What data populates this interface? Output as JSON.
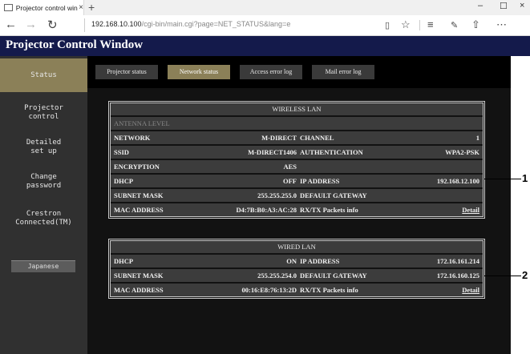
{
  "browser": {
    "tab_title": "Projector control windov",
    "tab_close": "×",
    "new_tab": "+",
    "window_controls": {
      "minimize": "–",
      "maximize": "☐",
      "close": "×"
    },
    "nav": {
      "back": "←",
      "forward": "→",
      "refresh": "↻"
    },
    "url_host": "192.168.10.100",
    "url_path": "/cgi-bin/main.cgi?page=NET_STATUS&lang=e",
    "toolbar_icons": [
      "reading-view-icon",
      "favorites-star-icon",
      "hub-icon",
      "web-note-icon",
      "share-icon",
      "more-icon"
    ]
  },
  "page": {
    "title": "Projector Control Window"
  },
  "sidebar": {
    "items": [
      {
        "label": "Status",
        "active": true
      },
      {
        "label": "Projector\ncontrol",
        "active": false
      },
      {
        "label": "Detailed\nset up",
        "active": false
      },
      {
        "label": "Change\npassword",
        "active": false
      },
      {
        "label": "Crestron\nConnected(TM)",
        "active": false
      }
    ],
    "language_button": "Japanese"
  },
  "subnav": {
    "tabs": [
      {
        "label": "Projector status",
        "active": false
      },
      {
        "label": "Network status",
        "active": true
      },
      {
        "label": "Access error log",
        "active": false
      },
      {
        "label": "Mail error log",
        "active": false
      }
    ]
  },
  "wireless": {
    "header": "WIRELESS LAN",
    "antenna_label": "ANTENNA LEVEL",
    "network_label": "NETWORK",
    "network_value": "M-DIRECT",
    "channel_label": "CHANNEL",
    "channel_value": "1",
    "ssid_label": "SSID",
    "ssid_value": "M-DIRECT1406",
    "auth_label": "AUTHENTICATION",
    "auth_value": "WPA2-PSK",
    "encryption_label": "ENCRYPTION",
    "encryption_value": "AES",
    "dhcp_label": "DHCP",
    "dhcp_value": "OFF",
    "ip_label": "IP ADDRESS",
    "ip_value": "192.168.12.100",
    "subnet_label": "SUBNET MASK",
    "subnet_value": "255.255.255.0",
    "gateway_label": "DEFAULT GATEWAY",
    "gateway_value": "",
    "mac_label": "MAC ADDRESS",
    "mac_value": "D4:7B:B0:A3:AC:28",
    "rxtx_label": "RX/TX Packets info",
    "detail_link": "Detail"
  },
  "wired": {
    "header": "WIRED LAN",
    "dhcp_label": "DHCP",
    "dhcp_value": "ON",
    "ip_label": "IP ADDRESS",
    "ip_value": "172.16.161.214",
    "subnet_label": "SUBNET MASK",
    "subnet_value": "255.255.254.0",
    "gateway_label": "DEFAULT GATEWAY",
    "gateway_value": "172.16.160.125",
    "mac_label": "MAC ADDRESS",
    "mac_value": "00:16:E8:76:13:2D",
    "rxtx_label": "RX/TX Packets info",
    "detail_link": "Detail"
  },
  "callouts": [
    "1",
    "2"
  ]
}
